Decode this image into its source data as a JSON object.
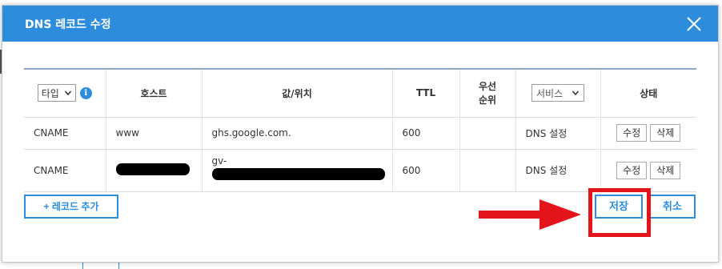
{
  "modal": {
    "title": "DNS 레코드 수정"
  },
  "table": {
    "headers": {
      "type_select": "타입",
      "host": "호스트",
      "value": "값/위치",
      "ttl": "TTL",
      "priority_line1": "우선",
      "priority_line2": "순위",
      "service_select": "서비스",
      "status": "상태"
    },
    "rows": [
      {
        "type": "CNAME",
        "host": "www",
        "value": "ghs.google.com.",
        "ttl": "600",
        "priority": "",
        "service": "DNS 설정",
        "edit": "수정",
        "delete": "삭제"
      },
      {
        "type": "CNAME",
        "host": "",
        "value": "gv-",
        "ttl": "600",
        "priority": "",
        "service": "DNS 설정",
        "edit": "수정",
        "delete": "삭제"
      }
    ]
  },
  "footer": {
    "add_record": "+ 레코드 추가",
    "save": "저장",
    "cancel": "취소"
  },
  "annotation": {
    "color": "#e3151a"
  },
  "colors": {
    "accent": "#2d8ddc"
  },
  "icons": {
    "info": "i"
  }
}
